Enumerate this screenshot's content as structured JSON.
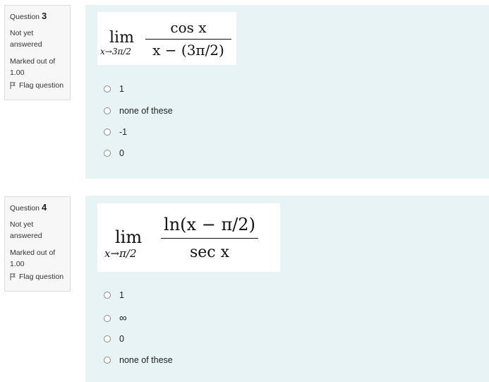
{
  "questions": [
    {
      "number_label": "Question",
      "number": "3",
      "status": [
        "Not yet",
        "answered"
      ],
      "marks": [
        "Marked out of",
        "1.00"
      ],
      "flag_label": "Flag question",
      "formula": {
        "lim": "lim",
        "sub": "x→3π/2",
        "numerator": "cos x",
        "denominator": "x − (3π/2)"
      },
      "options": [
        "1",
        "none of these",
        "-1",
        "0"
      ]
    },
    {
      "number_label": "Question",
      "number": "4",
      "status": [
        "Not yet",
        "answered"
      ],
      "marks": [
        "Marked out of",
        "1.00"
      ],
      "flag_label": "Flag question",
      "formula": {
        "lim": "lim",
        "sub": "x→π/2",
        "numerator": "ln(x − π/2)",
        "denominator": "sec x"
      },
      "options": [
        "1",
        "∞",
        "0",
        "none of these"
      ]
    }
  ],
  "colors": {
    "content_bg": "#e7f3f5",
    "info_bg": "#f7f7f7",
    "info_border": "#dcdcdc"
  }
}
